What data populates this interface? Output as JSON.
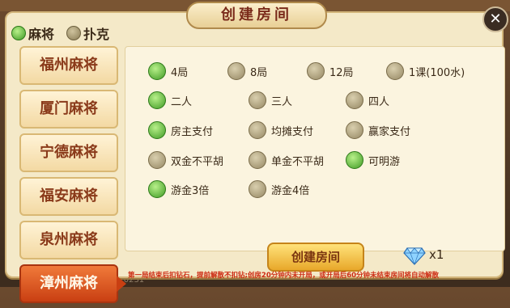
{
  "title": "创建房间",
  "mode": {
    "mahjong_label": "麻将",
    "poker_label": "扑克"
  },
  "tabs": [
    "福州麻将",
    "厦门麻将",
    "宁德麻将",
    "福安麻将",
    "泉州麻将",
    "漳州麻将"
  ],
  "active_tab": "漳州麻将",
  "options": {
    "rounds": [
      {
        "label": "4局",
        "selected": true
      },
      {
        "label": "8局",
        "selected": false
      },
      {
        "label": "12局",
        "selected": false
      },
      {
        "label": "1课(100水)",
        "selected": false
      }
    ],
    "players": [
      {
        "label": "二人",
        "selected": true
      },
      {
        "label": "三人",
        "selected": false
      },
      {
        "label": "四人",
        "selected": false
      }
    ],
    "payment": [
      {
        "label": "房主支付",
        "selected": true
      },
      {
        "label": "均摊支付",
        "selected": false
      },
      {
        "label": "赢家支付",
        "selected": false
      }
    ],
    "rules": [
      {
        "label": "双金不平胡",
        "selected": false
      },
      {
        "label": "单金不平胡",
        "selected": false
      },
      {
        "label": "可明游",
        "selected": true
      }
    ],
    "multiplier": [
      {
        "label": "游金3倍",
        "selected": true
      },
      {
        "label": "游金4倍",
        "selected": false
      }
    ]
  },
  "create_button": "创建房间",
  "cost": "x1",
  "notice": "第一局结束后扣钻石，提前解散不扣钻;创房20分钟内未开局，或开局后60分钟未结束房间将自动解散",
  "background": {
    "left_value": "98",
    "right_value": "370231"
  },
  "colors": {
    "accent": "#d2541a",
    "selected": "#3f9a24",
    "unselected": "#958763"
  }
}
